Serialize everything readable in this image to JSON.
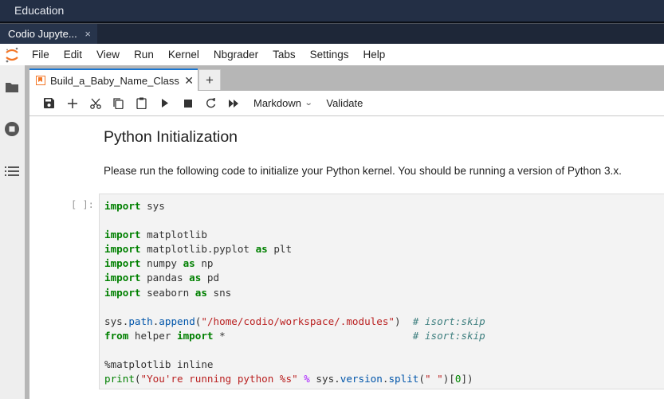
{
  "os_bar": {
    "title": "Education"
  },
  "browser_tab": {
    "title": "Codio Jupyte...",
    "close": "×"
  },
  "menubar": {
    "items": [
      "File",
      "Edit",
      "View",
      "Run",
      "Kernel",
      "Nbgrader",
      "Tabs",
      "Settings",
      "Help"
    ]
  },
  "sidebar": {
    "icons": [
      "folder-icon",
      "running-icon",
      "toc-icon"
    ]
  },
  "dock": {
    "tab_title": "Build_a_Baby_Name_Class",
    "tab_close": "✕",
    "add_tab": "+"
  },
  "toolbar": {
    "buttons": [
      "save",
      "insert-cell",
      "cut",
      "copy",
      "paste",
      "run",
      "stop",
      "restart",
      "run-all"
    ],
    "cell_type": "Markdown",
    "validate": "Validate"
  },
  "notebook": {
    "heading": "Python Initialization",
    "paragraph": "Please run the following code to initialize your Python kernel. You should be running a version of Python 3.x.",
    "prompt": "[ ]:",
    "code_lines": [
      "import sys",
      "",
      "import matplotlib",
      "import matplotlib.pyplot as plt",
      "import numpy as np",
      "import pandas as pd",
      "import seaborn as sns",
      "",
      "sys.path.append(\"/home/codio/workspace/.modules\")  # isort:skip",
      "from helper import *                               # isort:skip",
      "",
      "%matplotlib inline",
      "print(\"You're running python %s\" % sys.version.split(\" \")[0])"
    ]
  },
  "colors": {
    "os_bar": "#232f45",
    "tab_strip": "#1e2738",
    "accent_blue": "#1976d2",
    "jupyter_orange": "#f37626",
    "keyword_green": "#008000",
    "string_red": "#ba2121",
    "comment_teal": "#408080"
  }
}
